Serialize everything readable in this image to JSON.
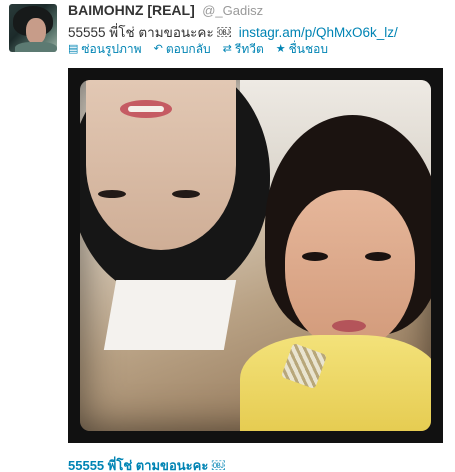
{
  "tweet": {
    "fullname": "BAIMOHNZ [REAL]",
    "username": "@_Gadisz",
    "text": "55555 พี่โช่ ตามขอนะคะ ￼",
    "link": "instagr.am/p/QhMxO6k_lz/"
  },
  "actions": [
    {
      "icon": "image-icon",
      "label": "ซ่อนรูปภาพ"
    },
    {
      "icon": "reply-icon",
      "label": "ตอบกลับ"
    },
    {
      "icon": "retweet-icon",
      "label": "รีทวีต"
    },
    {
      "icon": "star-icon",
      "label": "ชื่นชอบ"
    }
  ],
  "photo": {
    "caption": "55555 พี่โช่ ตามขอนะคะ ￼"
  },
  "colors": {
    "link": "#0084b4",
    "text": "#333333",
    "muted": "#999999"
  }
}
